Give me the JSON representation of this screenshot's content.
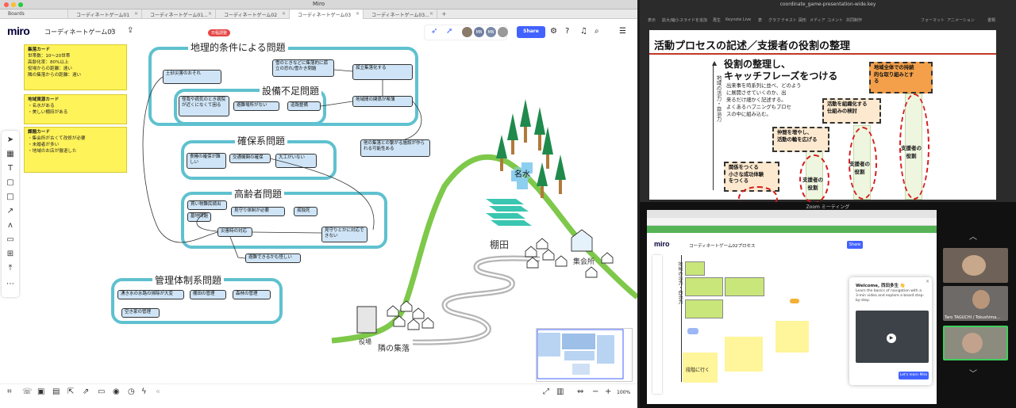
{
  "mac": {
    "title": "Miro"
  },
  "tabs": [
    {
      "label": "Boards"
    },
    {
      "label": "コーディネートゲーム01"
    },
    {
      "label": "コーディネートゲーム01..."
    },
    {
      "label": "コーディネートゲーム02"
    },
    {
      "label": "コーディネートゲーム03"
    },
    {
      "label": "コーディネートゲーム03..."
    }
  ],
  "toolbar": {
    "logo": "miro",
    "board_title": "コーディネートゲーム03",
    "timer_badge": "日程調整",
    "share_label": "Share"
  },
  "avatars": [
    {
      "initials": "",
      "color": "#8a7a6a"
    },
    {
      "initials": "MN",
      "color": "#6f7ea0"
    },
    {
      "initials": "MN",
      "color": "#7a8aa8"
    },
    {
      "initials": "",
      "color": "#999"
    }
  ],
  "cards_yellow": [
    {
      "title": "集落カード",
      "lines": [
        "世帯数：10〜20世帯",
        "高齢化率：80%以上",
        "役場からの距離：遠い",
        "隣の集落からの距離：遠い"
      ]
    },
    {
      "title": "地域資源カード",
      "lines": [
        "・名水がある",
        "・美しい棚田がある"
      ]
    },
    {
      "title": "課題カード",
      "lines": [
        "・集会所が古くて改修が必要",
        "・未婚者が多い",
        "・地域のお店が撤退した"
      ]
    }
  ],
  "groups": {
    "geo": {
      "title": "地理的条件による問題",
      "cards": [
        "土砂災害のおそれ",
        "雪のときなどに集落的に孤立の恐れ/雪かき問題",
        "孤立集落化する",
        "地域間の関係が希薄"
      ]
    },
    "infra": {
      "title": "設備不足問題",
      "cards": [
        "怪我や病気のとき病院が近くになくて困る",
        "避難場所がない",
        "道路整備"
      ]
    },
    "security": {
      "title": "確保系問題",
      "cards": [
        "食糧の確保が難しい",
        "交通機関の確保",
        "大工がいない"
      ]
    },
    "elderly": {
      "title": "高齢者問題",
      "cards": [
        "買い物難民続出",
        "墓地問題",
        "見守り体制が必要",
        "孤独死",
        "災害時の対応",
        "見守りとかに対応できない",
        "避難できるかも怪しい"
      ]
    },
    "management": {
      "title": "管理体制系問題",
      "cards": [
        "湧き水の水路の掃除が大変",
        "棚田の管理",
        "森林の管理",
        "空き家の管理"
      ]
    },
    "floating_card": "他の集落との繋がる施設が作られる可能性ある"
  },
  "map_labels": {
    "water": "名水",
    "terraces": "棚田",
    "hall": "集会所",
    "office": "役場",
    "neighbor": "隣の集落"
  },
  "zoom_level": "100%",
  "keynote": {
    "file": "coordinate_game-presentation-wide.key",
    "tools": [
      "表示",
      "拡大/縮小",
      "スライドを追加",
      "再生",
      "Keynote Live",
      "表",
      "グラフ",
      "テキスト",
      "図形",
      "メディア",
      "コメント",
      "共同制作",
      "フォーマット",
      "アニメーション",
      "書類"
    ],
    "slide_title": "活動プロセスの記述／支援者の役割の整理",
    "heading": [
      "役割の整理し、",
      "キャッチフレーズをつける"
    ],
    "body": [
      "出来事を時系列に並べ、どのよう",
      "に展開させていくのか、出",
      "来るだけ細かく記述する。",
      "よくあるハプニングもプロセ",
      "スの中に組み込む。"
    ],
    "axis_label": "地域の活力・自治力",
    "steps": [
      {
        "text": [
          "関係をつくる",
          "小さな成功体験",
          "をつくる"
        ]
      },
      {
        "text": [
          "仲間を増やし、",
          "活動の輪を広げる"
        ]
      },
      {
        "text": [
          "活動を組織化する",
          "仕組みの検討"
        ]
      },
      {
        "text": [
          "地域全体での持続",
          "的な取り組みとす",
          "る"
        ]
      }
    ],
    "supporters": [
      "支援者の役割",
      "支援者の役割",
      "支援者の役割",
      "支援者の役割"
    ]
  },
  "zoom": {
    "title": "Zoom ミーティング",
    "participants": [
      {
        "name": ""
      },
      {
        "name": "Taro TAGUCHI / Tokushima..."
      },
      {
        "name": ""
      }
    ],
    "shared": {
      "board_title": "コーディネートゲーム02プロセス",
      "vertical_axis": "地域の活力・自治力",
      "sticky_label": "段階に行く",
      "welcome_title": "Welcome, 西田多生 👋",
      "welcome_body": "Learn the basics of navigation with a 3-min video and explore a board step-by-step.",
      "welcome_btn": "Let's learn Miro"
    }
  }
}
